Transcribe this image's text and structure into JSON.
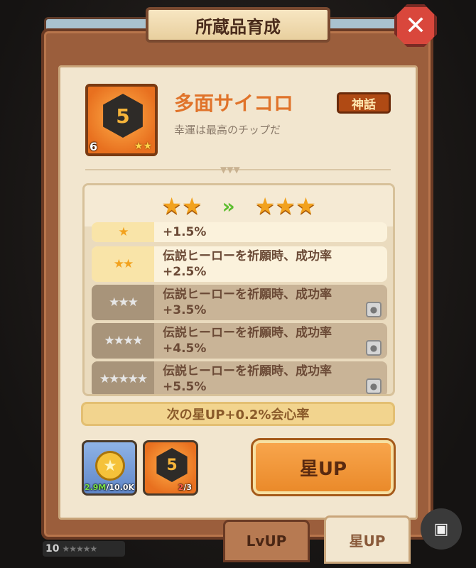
{
  "title": "所蔵品育成",
  "close_glyph": "✕",
  "item": {
    "name": "多面サイコロ",
    "rarity": "神話",
    "description": "幸運は最高のチップだ",
    "level": "6",
    "icon": "d20-dice-icon",
    "dice_face": "5",
    "star_count": 2
  },
  "star_compare": {
    "current_stars": 2,
    "next_stars": 3,
    "arrow": "»"
  },
  "upgrade_rows": [
    {
      "stars": 1,
      "text": "+1.5%",
      "locked": false
    },
    {
      "stars": 2,
      "text": "伝説ヒーローを祈願時、成功率\n+2.5%",
      "locked": false
    },
    {
      "stars": 3,
      "text": "伝説ヒーローを祈願時、成功率\n+3.5%",
      "locked": true
    },
    {
      "stars": 4,
      "text": "伝説ヒーローを祈願時、成功率\n+4.5%",
      "locked": true
    },
    {
      "stars": 5,
      "text": "伝説ヒーローを祈願時、成功率\n+5.5%",
      "locked": true
    }
  ],
  "next_bonus": "次の星UP+0.2%会心率",
  "costs": {
    "gold": {
      "icon": "gold-coin-icon",
      "have": "2.9M",
      "need": "/10.0K"
    },
    "dice": {
      "icon": "d20-dice-icon",
      "dice_face": "5",
      "have": "2",
      "need": "/3"
    }
  },
  "action_button": "星UP",
  "tabs": {
    "lvup": "LvUP",
    "starup": "星UP"
  },
  "background_level": {
    "value": "10",
    "stars": "★★★★★"
  },
  "scan_icon": "scan-text-icon",
  "colors": {
    "frame": "#9b5e3c",
    "panel": "#f2e6cf",
    "accent_orange": "#e0732a",
    "star_gold": "#f2a21e",
    "arrow_green": "#5cbd2e",
    "close_red": "#d9473c"
  }
}
